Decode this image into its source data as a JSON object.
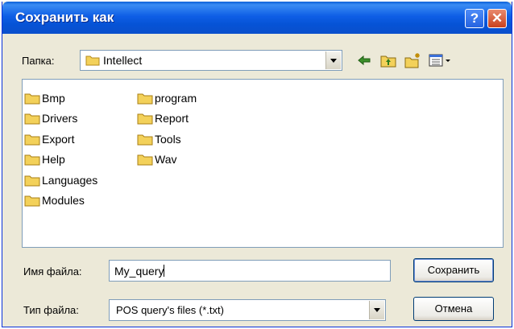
{
  "window": {
    "title": "Сохранить как"
  },
  "toolbar": {
    "folder_label": "Папка:",
    "current_folder": "Intellect"
  },
  "files": {
    "column1": [
      "Bmp",
      "Drivers",
      "Export",
      "Help",
      "Languages",
      "Modules"
    ],
    "column2": [
      "program",
      "Report",
      "Tools",
      "Wav"
    ]
  },
  "bottom": {
    "filename_label": "Имя файла:",
    "filename_value": "My_query",
    "filetype_label": "Тип файла:",
    "filetype_value": "POS query's files (*.txt)",
    "save_label": "Сохранить",
    "cancel_label": "Отмена"
  },
  "icons": {
    "folder": "folder-icon",
    "back": "back-arrow-icon",
    "up": "up-folder-icon",
    "new_folder": "new-folder-icon",
    "views": "view-menu-icon"
  },
  "colors": {
    "titlebar": "#0a4fcc",
    "folder_yellow": "#f3d15a",
    "window_bg": "#ece9d8"
  }
}
